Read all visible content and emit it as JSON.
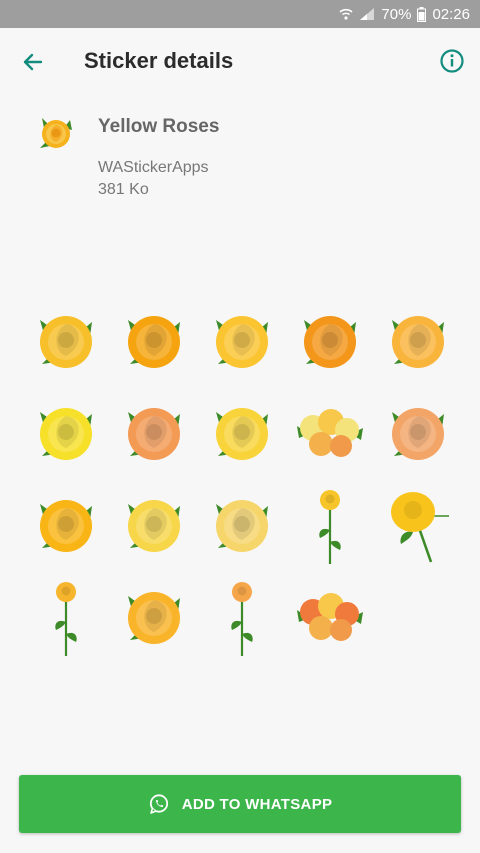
{
  "status_bar": {
    "battery": "70%",
    "time": "02:26",
    "icons": [
      "wifi-icon",
      "signal-icon",
      "battery-icon"
    ]
  },
  "app_bar": {
    "title": "Sticker details",
    "back_icon": "arrow-back-icon",
    "info_icon": "info-icon",
    "accent": "#128c7e"
  },
  "pack": {
    "name": "Yellow Roses",
    "publisher": "WAStickerApps",
    "size": "381 Ko",
    "tray_icon": "rose-icon"
  },
  "stickers": [
    {
      "type": "rose",
      "color": "#f7c02a"
    },
    {
      "type": "rose",
      "color": "#f5a40f"
    },
    {
      "type": "rose",
      "color": "#fbc531"
    },
    {
      "type": "rose",
      "color": "#f4961a"
    },
    {
      "type": "rose",
      "color": "#f9b43b"
    },
    {
      "type": "rose",
      "color": "#f7e029"
    },
    {
      "type": "rose",
      "color": "#f39a55"
    },
    {
      "type": "rose",
      "color": "#f8d43a"
    },
    {
      "type": "bouquet",
      "color": "#f4e27a"
    },
    {
      "type": "rose",
      "color": "#f2a567"
    },
    {
      "type": "rose",
      "color": "#f9b515"
    },
    {
      "type": "rose",
      "color": "#f7d64a"
    },
    {
      "type": "rose",
      "color": "#f6d56b"
    },
    {
      "type": "stem",
      "color": "#f7c52a"
    },
    {
      "type": "bud",
      "color": "#f8c41c"
    },
    {
      "type": "stem",
      "color": "#f6b52c"
    },
    {
      "type": "rose",
      "color": "#f9b42a"
    },
    {
      "type": "stem",
      "color": "#f5a64a"
    },
    {
      "type": "bouquet",
      "color": "#f07a3c"
    }
  ],
  "add_button": {
    "label": "ADD TO WHATSAPP",
    "icon": "whatsapp-icon",
    "color": "#3cb54a"
  }
}
